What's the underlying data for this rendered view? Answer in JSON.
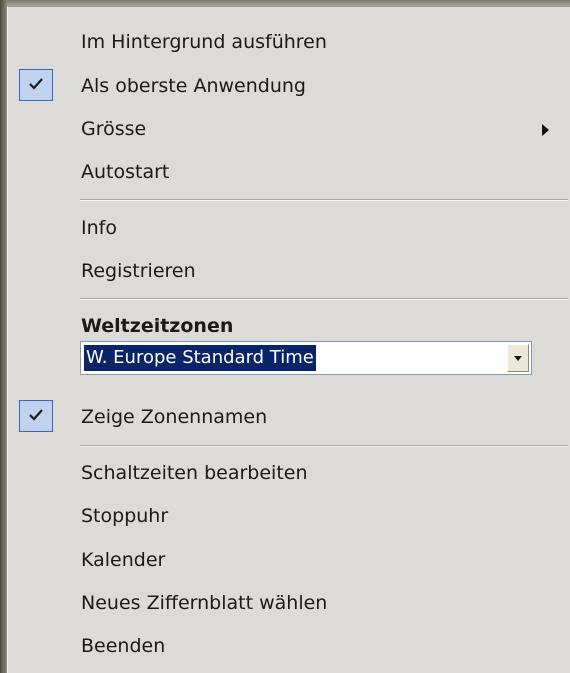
{
  "menu": {
    "items": [
      {
        "label": "Im Hintergrund ausführen",
        "checked": false
      },
      {
        "label": "Als oberste Anwendung",
        "checked": true
      },
      {
        "label": "Grösse",
        "submenu": true
      },
      {
        "label": "Autostart",
        "checked": false
      },
      {
        "label": "Info"
      },
      {
        "label": "Registrieren"
      },
      {
        "label": "Weltzeitzonen",
        "bold": true
      },
      {
        "label": "Zeige Zonennamen",
        "checked": true
      },
      {
        "label": "Schaltzeiten bearbeiten"
      },
      {
        "label": "Stoppuhr"
      },
      {
        "label": "Kalender"
      },
      {
        "label": "Neues Ziffernblatt wählen"
      },
      {
        "label": "Beenden"
      }
    ],
    "timezone_combo": {
      "selected": "W. Europe Standard Time"
    }
  },
  "colors": {
    "menu_bg": "#dddbd7",
    "check_bg": "#c1d2ee",
    "check_border": "#316ac5",
    "selection_bg": "#0a246a"
  },
  "icons": {
    "check": "checkmark-icon",
    "submenu": "chevron-right-icon",
    "combo": "dropdown-arrow-icon"
  }
}
